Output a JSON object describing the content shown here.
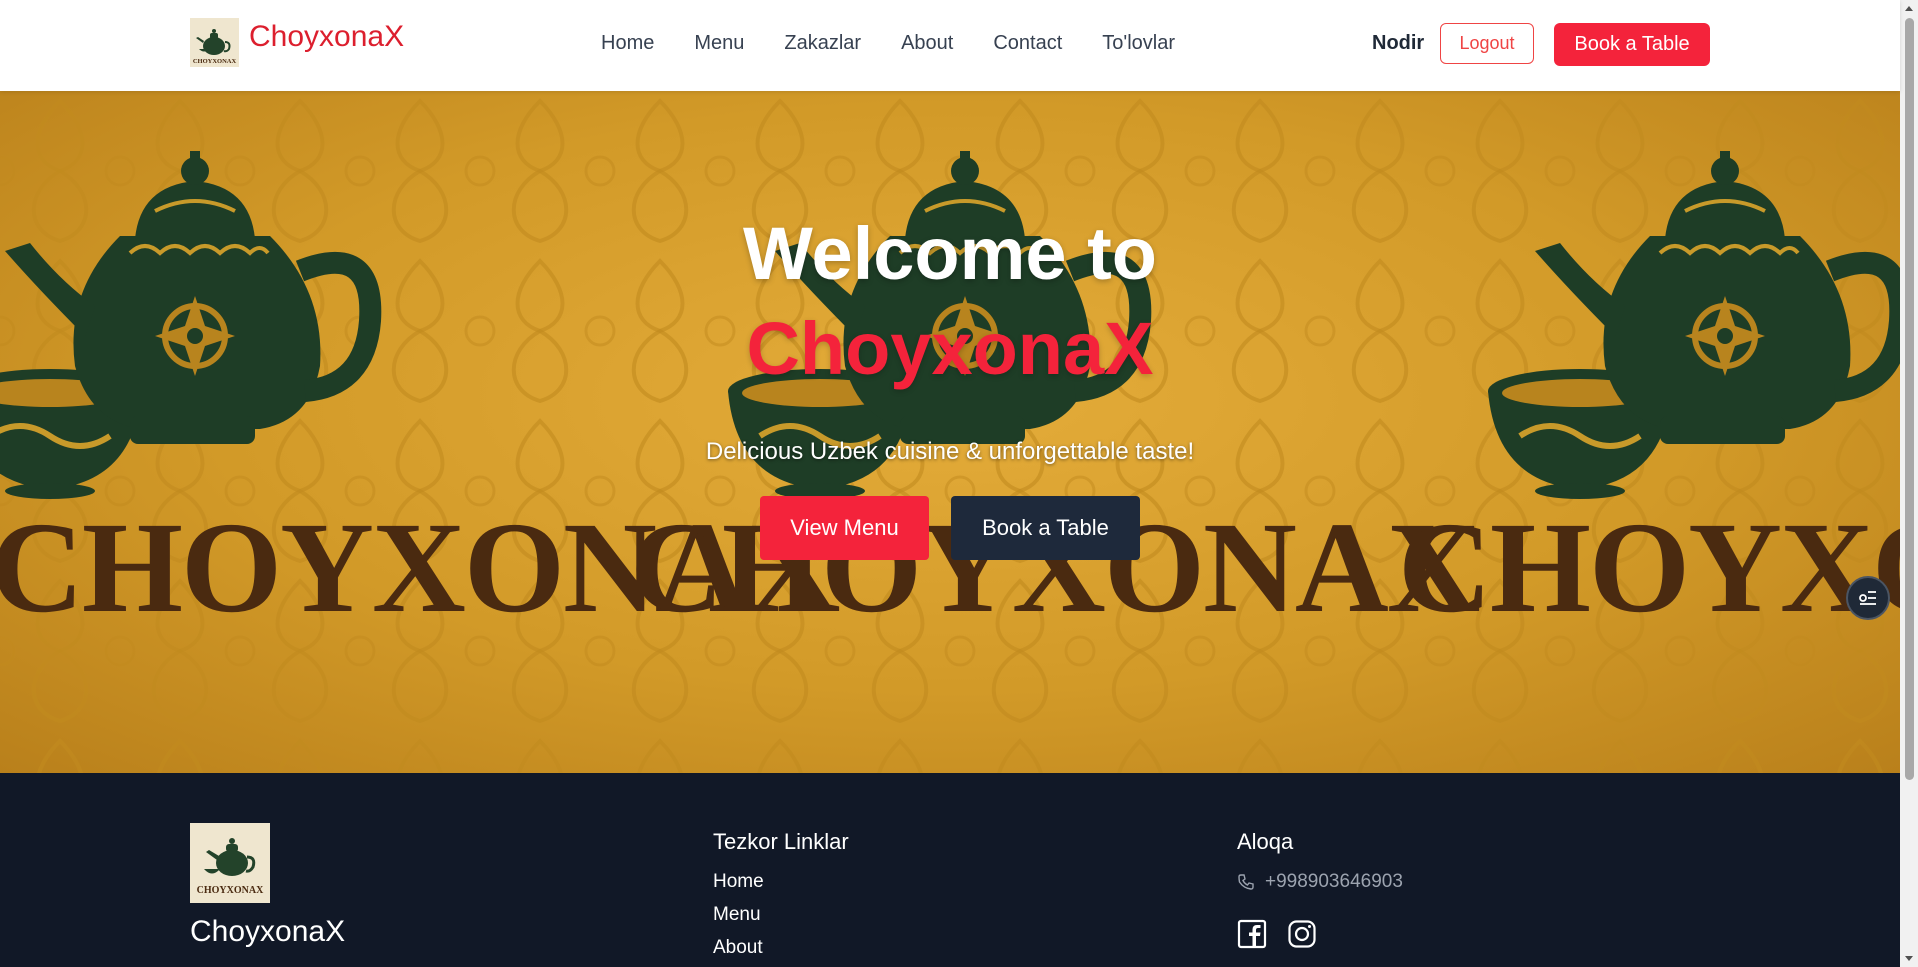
{
  "brand": {
    "name": "ChoyxonaX",
    "logo_text": "CHOYXONAX"
  },
  "nav": {
    "items": [
      {
        "label": "Home"
      },
      {
        "label": "Menu"
      },
      {
        "label": "Zakazlar"
      },
      {
        "label": "About"
      },
      {
        "label": "Contact"
      },
      {
        "label": "To'lovlar"
      }
    ]
  },
  "user": {
    "name": "Nodir",
    "logout_label": "Logout",
    "book_label": "Book a Table"
  },
  "hero": {
    "title_line1": "Welcome to",
    "title_line2": "ChoyxonaX",
    "subtitle": "Delicious Uzbek cuisine & unforgettable taste!",
    "view_menu_label": "View Menu",
    "book_label": "Book a Table",
    "bg_brand_text": "CHOYXONAX"
  },
  "footer": {
    "brand_name": "ChoyxonaX",
    "quick_links_title": "Tezkor Linklar",
    "quick_links": [
      {
        "label": "Home"
      },
      {
        "label": "Menu"
      },
      {
        "label": "About"
      }
    ],
    "contact_title": "Aloqa",
    "phone": "+998903646903",
    "socials": [
      "facebook-icon",
      "instagram-icon"
    ]
  },
  "colors": {
    "accent": "#f4233b",
    "brand_red": "#dc1f2e",
    "dark": "#1e293b",
    "footer_bg": "#111827",
    "hero_gold": "#d29a28",
    "pot_green": "#1e3d26",
    "text_brown": "#4a2a10"
  }
}
